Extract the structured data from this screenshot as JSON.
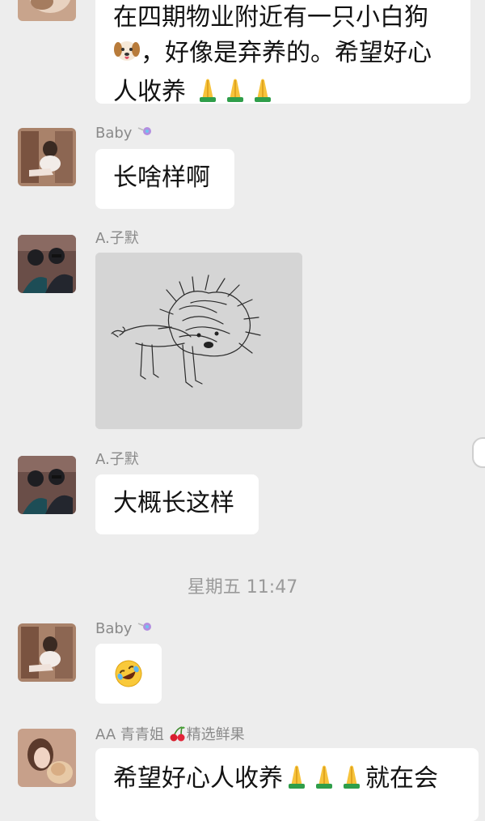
{
  "messages": [
    {
      "id": "msg1",
      "text_line1": "在四期物业附近有一只小白狗",
      "text_line2": "，好像是弃养的。希望好心",
      "text_line3": "人收养",
      "emoji": [
        "dog-face",
        "folded-hands",
        "folded-hands",
        "folded-hands"
      ]
    },
    {
      "id": "msg2",
      "sender": "Baby",
      "sender_badge": "lollipop",
      "text": "长啥样啊"
    },
    {
      "id": "msg3",
      "sender": "A.子默",
      "image": "drawing-of-shaggy-dog"
    },
    {
      "id": "msg4",
      "sender": "A.子默",
      "text": "大概长这样"
    },
    {
      "id": "msg5",
      "sender": "Baby",
      "sender_badge": "lollipop",
      "emoji": "rolling-on-floor-laughing"
    },
    {
      "id": "msg6",
      "sender_prefix": "AA 青青姐",
      "sender_suffix": "精选鲜果",
      "sender_emoji": "cherries",
      "text_prefix": "希望好心人收养",
      "text_suffix": "就在会",
      "emoji": [
        "folded-hands",
        "folded-hands",
        "folded-hands"
      ]
    }
  ],
  "timestamp": "星期五 11:47",
  "colors": {
    "background": "#ededed",
    "bubble": "#ffffff",
    "name": "#8a8a8a",
    "timestamp": "#9a9a9a"
  }
}
